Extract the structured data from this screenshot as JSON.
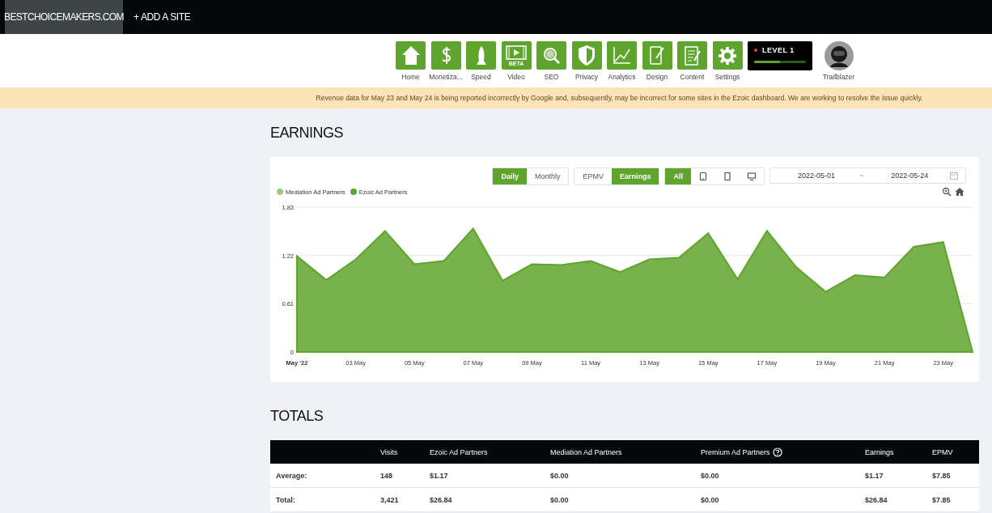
{
  "top_bar": {
    "site": "BESTCHOICEMAKERS.COM",
    "add_site": "+ ADD A SITE"
  },
  "nav": {
    "items": [
      {
        "label": "Home",
        "selected": false
      },
      {
        "label": "Monetiza...",
        "selected": false
      },
      {
        "label": "Speed",
        "selected": false
      },
      {
        "label": "Video",
        "selected": false,
        "badge": "BETA"
      },
      {
        "label": "SEO",
        "selected": false
      },
      {
        "label": "Privacy",
        "selected": false
      },
      {
        "label": "Analytics",
        "selected": false
      },
      {
        "label": "Design",
        "selected": false
      },
      {
        "label": "Content",
        "selected": false
      },
      {
        "label": "Settings",
        "selected": false
      }
    ],
    "level_badge": {
      "label": "LEVEL 1",
      "level": 0.5
    },
    "profile": {
      "label": "Trailblazer"
    }
  },
  "banner": "Revenue data for May 23 and May 24 is being reported incorrectly by Google and, subsequently, may be incorrect for some sites in the Ezoic dashboard. We are working to resolve the issue quickly.",
  "earnings": {
    "title": "EARNINGS",
    "period": [
      {
        "label": "Daily",
        "selected": true
      },
      {
        "label": "Monthly",
        "selected": false
      }
    ],
    "metric": [
      {
        "label": "EPMV",
        "selected": false
      },
      {
        "label": "Earnings",
        "selected": true
      }
    ],
    "device": [
      {
        "kind": "all",
        "label": "All",
        "selected": true
      },
      {
        "kind": "tablet",
        "selected": false
      },
      {
        "kind": "phone",
        "selected": false
      },
      {
        "kind": "desktop",
        "selected": false
      }
    ],
    "date_range": {
      "start": "2022-05-01",
      "separator": "~",
      "end": "2022-05-24"
    },
    "legend": [
      {
        "label": "Mediation Ad Partners",
        "color": "#9ccc7c"
      },
      {
        "label": "Ezoic Ad Partners",
        "color": "#5fa52d"
      }
    ],
    "chart_data": {
      "type": "area",
      "categories": [
        "May '22",
        null,
        "03 May",
        null,
        "05 May",
        null,
        "07 May",
        null,
        "09 May",
        null,
        "11 May",
        null,
        "13 May",
        null,
        "15 May",
        null,
        "17 May",
        null,
        "19 May",
        null,
        "21 May",
        null,
        "23 May",
        null
      ],
      "series": [
        {
          "color": "#5fa52d",
          "values": [
            1.21,
            0.91,
            1.17,
            1.53,
            1.11,
            1.15,
            1.56,
            0.9,
            1.11,
            1.1,
            1.15,
            1.01,
            1.17,
            1.19,
            1.5,
            0.92,
            1.53,
            1.07,
            0.76,
            0.97,
            0.94,
            1.33,
            1.39,
            0
          ]
        }
      ],
      "ylim": [
        0,
        1.83
      ],
      "yticks": [
        0,
        0.61,
        1.22,
        1.83
      ]
    }
  },
  "totals": {
    "title": "TOTALS",
    "columns": [
      {
        "label": "Visits"
      },
      {
        "label": "Ezoic Ad Partners"
      },
      {
        "label": "Mediation Ad Partners"
      },
      {
        "label": "Premium Ad Partners",
        "help": true
      },
      {
        "label": "Earnings"
      },
      {
        "label": "EPMV"
      }
    ],
    "rows": [
      {
        "label": "Average:",
        "cells": [
          "148",
          "$1.17",
          "$0.00",
          "$0.00",
          "$1.17",
          "$7.85"
        ]
      },
      {
        "label": "Total:",
        "cells": [
          "3,421",
          "$26.84",
          "$0.00",
          "$0.00",
          "$26.84",
          "$7.85"
        ]
      }
    ]
  }
}
